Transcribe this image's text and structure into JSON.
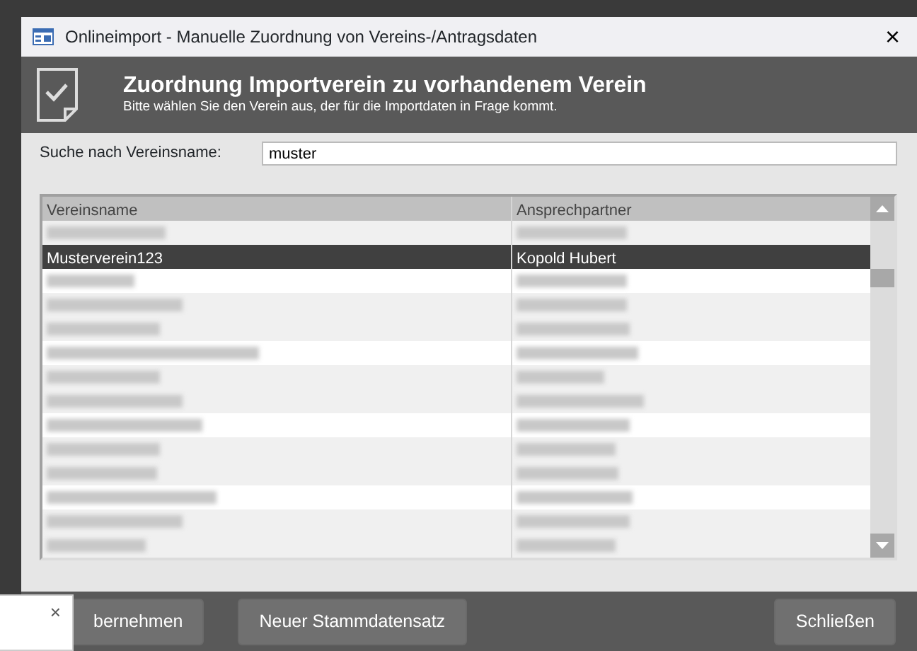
{
  "window": {
    "title": "Onlineimport - Manuelle Zuordnung von Vereins-/Antragsdaten",
    "close": "×"
  },
  "header": {
    "title": "Zuordnung Importverein zu vorhandenem Verein",
    "subtitle": "Bitte wählen Sie den Verein aus, der für die Importdaten in Frage kommt."
  },
  "search": {
    "label": "Suche nach Vereinsname:",
    "value": "muster"
  },
  "table": {
    "columns": [
      "Vereinsname",
      "Ansprechpartner"
    ],
    "rows": [
      {
        "kind": "blurred",
        "selected": false
      },
      {
        "kind": "text",
        "selected": true,
        "cells": [
          "Musterverein123",
          "Kopold Hubert"
        ]
      },
      {
        "kind": "blurred",
        "selected": false
      },
      {
        "kind": "blurred",
        "selected": false
      },
      {
        "kind": "blurred",
        "selected": false
      },
      {
        "kind": "blurred",
        "selected": false
      },
      {
        "kind": "blurred",
        "selected": false
      },
      {
        "kind": "blurred",
        "selected": false
      },
      {
        "kind": "blurred",
        "selected": false
      },
      {
        "kind": "blurred",
        "selected": false
      },
      {
        "kind": "blurred",
        "selected": false
      },
      {
        "kind": "blurred",
        "selected": false
      },
      {
        "kind": "blurred",
        "selected": false
      },
      {
        "kind": "blurred",
        "selected": false
      }
    ]
  },
  "buttons": [
    "bernehmen",
    "Neuer Stammdatensatz",
    "Schließen"
  ],
  "popup": {
    "close": "×"
  }
}
